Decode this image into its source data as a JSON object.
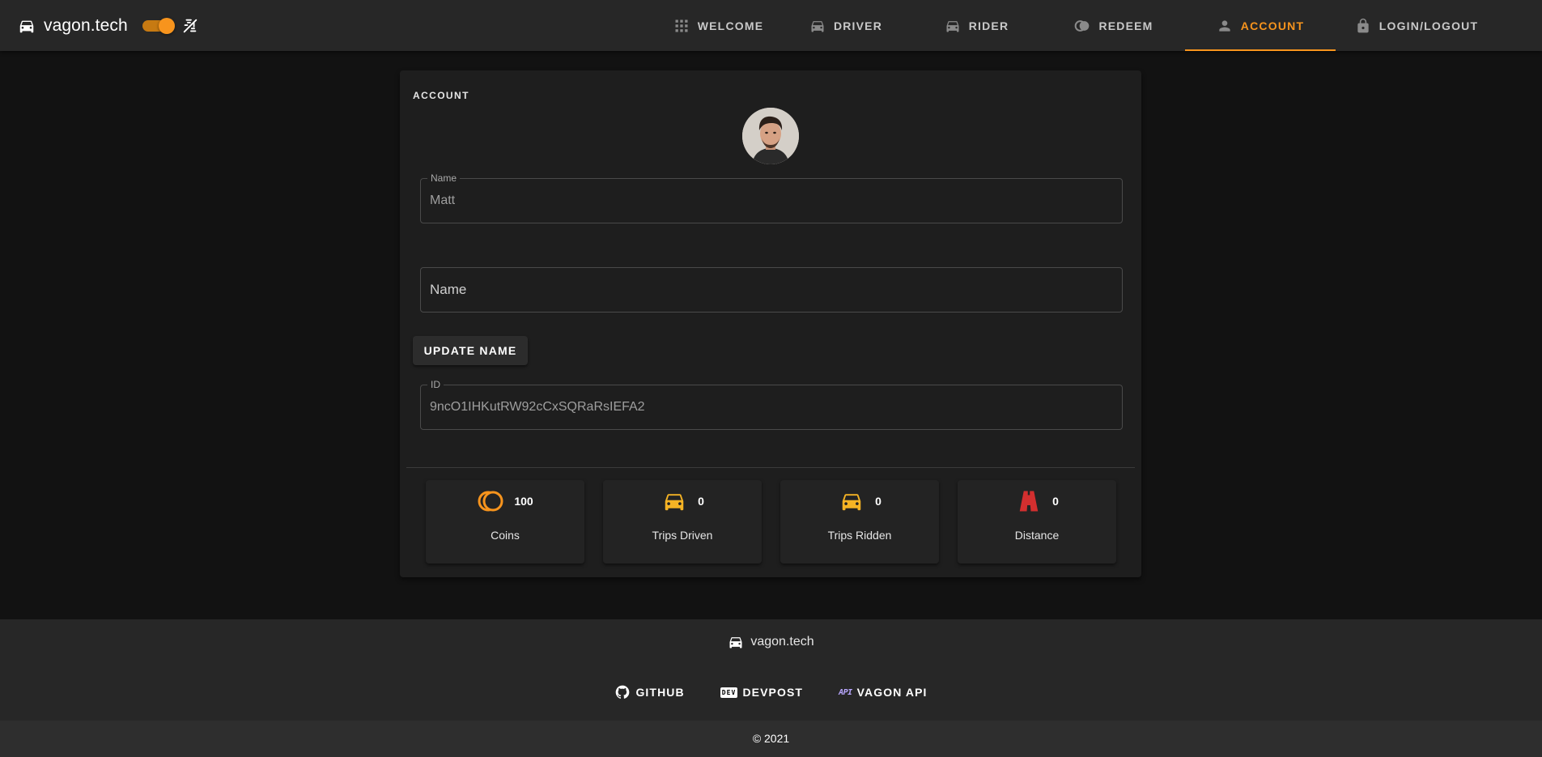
{
  "header": {
    "brand": "vagon.tech",
    "theme_toggle_on": true,
    "nav": [
      {
        "label": "Welcome",
        "icon": "grid-icon",
        "active": false
      },
      {
        "label": "Driver",
        "icon": "car-icon",
        "active": false
      },
      {
        "label": "Rider",
        "icon": "car-icon",
        "active": false
      },
      {
        "label": "Redeem",
        "icon": "coins-icon",
        "active": false
      },
      {
        "label": "Account",
        "icon": "person-icon",
        "active": true
      },
      {
        "label": "Login/Logout",
        "icon": "lock-icon",
        "active": false
      }
    ]
  },
  "account": {
    "title": "ACCOUNT",
    "name_label": "Name",
    "name_value": "Matt",
    "new_name_placeholder": "Name",
    "update_button": "UPDATE NAME",
    "id_label": "ID",
    "id_value": "9ncO1IHKutRW92cCxSQRaRsIEFA2",
    "stats": [
      {
        "label": "Coins",
        "value": "100",
        "icon": "coins-icon"
      },
      {
        "label": "Trips Driven",
        "value": "0",
        "icon": "car-icon"
      },
      {
        "label": "Trips Ridden",
        "value": "0",
        "icon": "car-icon"
      },
      {
        "label": "Distance",
        "value": "0",
        "icon": "road-icon"
      }
    ]
  },
  "footer": {
    "brand": "vagon.tech",
    "links": [
      {
        "label": "GITHUB",
        "icon": "github-icon"
      },
      {
        "label": "DEVPOST",
        "icon": "dev-icon",
        "badge": "DEV"
      },
      {
        "label": "VAGON API",
        "icon": "api-icon",
        "badge": "API"
      }
    ],
    "copyright": "© 2021"
  },
  "colors": {
    "accent": "#f7941d",
    "car_yellow": "#f5b324",
    "road_red": "#d32f2f",
    "appbar": "#272727",
    "background": "#121212",
    "card": "#1e1e1e"
  }
}
